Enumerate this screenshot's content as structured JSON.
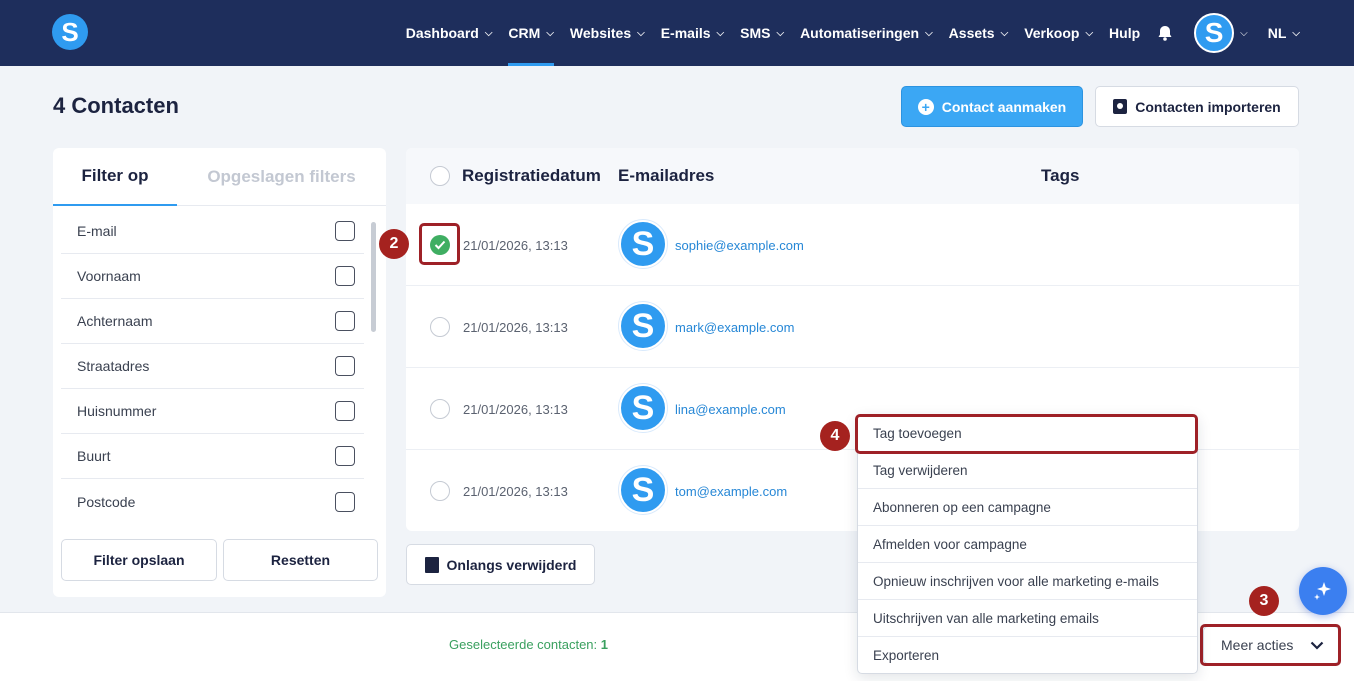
{
  "app": {
    "logo_letter": "S"
  },
  "nav": {
    "items": [
      {
        "label": "Dashboard",
        "has_dropdown": true,
        "active": false
      },
      {
        "label": "CRM",
        "has_dropdown": true,
        "active": true
      },
      {
        "label": "Websites",
        "has_dropdown": true,
        "active": false
      },
      {
        "label": "E-mails",
        "has_dropdown": true,
        "active": false
      },
      {
        "label": "SMS",
        "has_dropdown": true,
        "active": false
      },
      {
        "label": "Automatiseringen",
        "has_dropdown": true,
        "active": false
      },
      {
        "label": "Assets",
        "has_dropdown": true,
        "active": false
      },
      {
        "label": "Verkoop",
        "has_dropdown": true,
        "active": false
      },
      {
        "label": "Hulp",
        "has_dropdown": false,
        "active": false
      }
    ],
    "avatar_letter": "S",
    "language": "NL"
  },
  "header": {
    "title": "4 Contacten",
    "create_button": "Contact aanmaken",
    "import_button": "Contacten importeren"
  },
  "filter": {
    "tab_active": "Filter op",
    "tab_inactive": "Opgeslagen filters",
    "fields": [
      "E-mail",
      "Voornaam",
      "Achternaam",
      "Straatadres",
      "Huisnummer",
      "Buurt",
      "Postcode"
    ],
    "save_button": "Filter opslaan",
    "reset_button": "Resetten"
  },
  "table": {
    "columns": {
      "date": "Registratiedatum",
      "email": "E-mailadres",
      "tags": "Tags"
    },
    "rows": [
      {
        "date": "21/01/2026, 13:13",
        "avatar": "S",
        "email": "sophie@example.com",
        "selected": true
      },
      {
        "date": "21/01/2026, 13:13",
        "avatar": "S",
        "email": "mark@example.com",
        "selected": false
      },
      {
        "date": "21/01/2026, 13:13",
        "avatar": "S",
        "email": "lina@example.com",
        "selected": false
      },
      {
        "date": "21/01/2026, 13:13",
        "avatar": "S",
        "email": "tom@example.com",
        "selected": false
      }
    ]
  },
  "recently_deleted_button": "Onlangs verwijderd",
  "bottom": {
    "selected_label": "Geselecteerde contacten:",
    "selected_count": "1",
    "more_actions": "Meer acties"
  },
  "dropdown": {
    "items": [
      "Tag toevoegen",
      "Tag verwijderen",
      "Abonneren op een campagne",
      "Afmelden voor campagne",
      "Opnieuw inschrijven voor alle marketing e-mails",
      "Uitschrijven van alle marketing emails",
      "Exporteren"
    ]
  },
  "steps": {
    "step2": "2",
    "step3": "3",
    "step4": "4"
  },
  "colors": {
    "nav_bg": "#1e2e5c",
    "primary": "#3ba7f4",
    "accent_blue": "#2f9bf0",
    "success": "#3fae62",
    "highlight": "#9e2127"
  }
}
